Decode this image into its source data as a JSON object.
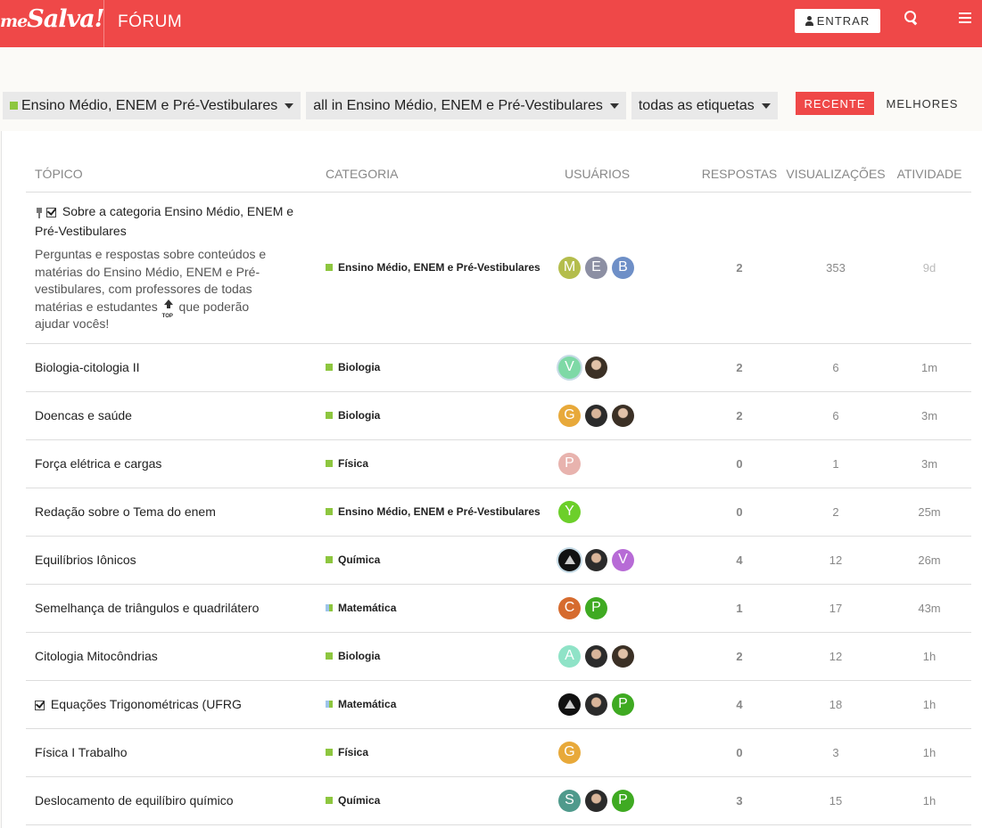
{
  "header": {
    "logo_me": "me",
    "logo_salva": "Salva!",
    "title": "FÓRUM",
    "login_label": "ENTRAR"
  },
  "filters": {
    "category": "Ensino Médio, ENEM e Pré-Vestibulares",
    "subcategory": "all in Ensino Médio, ENEM e Pré-Vestibulares",
    "tags": "todas as etiquetas",
    "category_color": "#8dc63f"
  },
  "tabs": {
    "recent": "RECENTE",
    "best": "MELHORES"
  },
  "columns": {
    "topic": "TÓPICO",
    "category": "CATEGORIA",
    "users": "USUÁRIOS",
    "replies": "RESPOSTAS",
    "views": "VISUALIZAÇÕES",
    "activity": "ATIVIDADE"
  },
  "pinned": {
    "title": "Sobre a categoria Ensino Médio, ENEM e Pré-Vestibulares",
    "excerpt_before": "Perguntas e respostas sobre conteúdos e matérias do Ensino Médio, ENEM e Pré-vestibulares, com professores de todas matérias e estudantes",
    "top_label": "TOP",
    "excerpt_after": "que poderão ajudar vocês!",
    "category": "Ensino Médio, ENEM e Pré-Vestibulares",
    "avatars": [
      "M",
      "E",
      "B"
    ],
    "replies": "2",
    "views": "353",
    "activity": "9d"
  },
  "topics": [
    {
      "title": "Biologia-citologia II",
      "category": "Biologia",
      "replies": "2",
      "views": "6",
      "activity": "1m"
    },
    {
      "title": "Doencas e saúde",
      "category": "Biologia",
      "replies": "2",
      "views": "6",
      "activity": "3m"
    },
    {
      "title": "Força elétrica e cargas",
      "category": "Física",
      "replies": "0",
      "views": "1",
      "activity": "3m"
    },
    {
      "title": "Redação sobre o Tema do enem",
      "category": "Ensino Médio, ENEM e Pré-Vestibulares",
      "replies": "0",
      "views": "2",
      "activity": "25m"
    },
    {
      "title": "Equilíbrios Iônicos",
      "category": "Química",
      "replies": "4",
      "views": "12",
      "activity": "26m"
    },
    {
      "title": "Semelhança de triângulos e quadrilátero",
      "category": "Matemática",
      "replies": "1",
      "views": "17",
      "activity": "43m"
    },
    {
      "title": "Citologia Mitocôndrias",
      "category": "Biologia",
      "replies": "2",
      "views": "12",
      "activity": "1h"
    },
    {
      "title": "Equações Trigonométricas (UFRG",
      "category": "Matemática",
      "replies": "4",
      "views": "18",
      "activity": "1h"
    },
    {
      "title": "Física I Trabalho",
      "category": "Física",
      "replies": "0",
      "views": "3",
      "activity": "1h"
    },
    {
      "title": "Deslocamento de equilíbiro químico",
      "category": "Química",
      "replies": "3",
      "views": "15",
      "activity": "1h"
    }
  ],
  "avatar_letters": {
    "r1": [
      "V"
    ],
    "r2": [
      "G"
    ],
    "r3": [
      "P"
    ],
    "r4": [
      "Y"
    ],
    "r5": [
      "V"
    ],
    "r6": [
      "C",
      "P"
    ],
    "r7": [
      "A"
    ],
    "r8": [
      "P"
    ],
    "r9": [
      "G"
    ],
    "r10": [
      "S",
      "P"
    ]
  }
}
